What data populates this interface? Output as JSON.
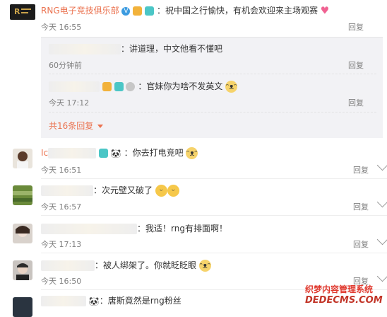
{
  "top": {
    "name": "RNG电子竞技俱乐部",
    "text": "：祝中国之行愉快，有机会欢迎来主场观赛",
    "time": "今天 16:55",
    "reply": "回复",
    "replies": [
      {
        "text": "：讲道理，中文他看不懂吧",
        "time": "60分钟前",
        "reply": "回复"
      },
      {
        "text": "：官妹你为啥不发英文",
        "time": "今天 17:12",
        "reply": "回复"
      }
    ],
    "more": "共16条回复"
  },
  "comments": [
    {
      "name_prefix": "Ic",
      "text": "：你去打电竞吧",
      "time": "今天 16:51",
      "reply": "回复"
    },
    {
      "text": "：次元壁又破了",
      "time": "今天 16:57",
      "reply": "回复"
    },
    {
      "text": "：我适！rng有排面啊！",
      "time": "今天 17:13",
      "reply": "回复"
    },
    {
      "text": "：被人绑架了。你就眨眨眼",
      "time": "今天 16:50",
      "reply": "回复"
    },
    {
      "text": "：唐斯竟然是rng粉丝"
    }
  ],
  "watermark": {
    "line1": "织梦内容管理系统",
    "line2": "DEDECMS.COM"
  },
  "colors": {
    "name": "#eb7350",
    "link": "#eb7350",
    "sub_bg": "#f2f2f5"
  }
}
